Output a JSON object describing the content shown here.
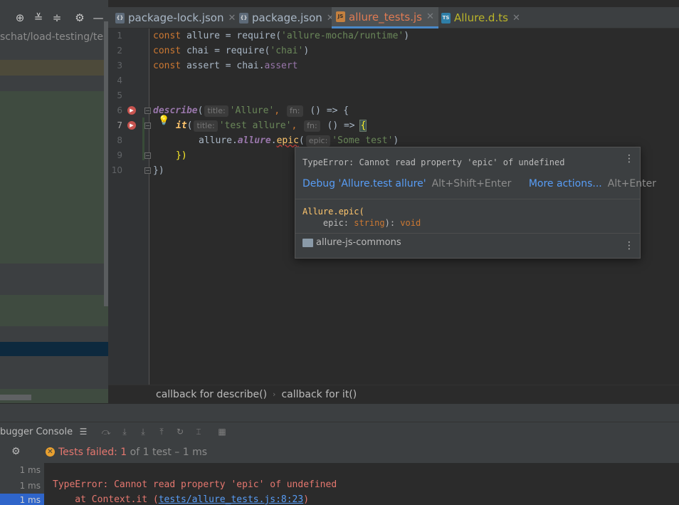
{
  "project_panel": {
    "path": "schat/load-testing/tes"
  },
  "tabs": [
    {
      "label": "package-lock.json",
      "icon": "json-file-icon"
    },
    {
      "label": "package.json",
      "icon": "json-file-icon"
    },
    {
      "label": "allure_tests.js",
      "icon": "js-file-icon",
      "active": true
    },
    {
      "label": "Allure.d.ts",
      "icon": "ts-file-icon"
    }
  ],
  "editor": {
    "line_numbers": [
      "1",
      "2",
      "3",
      "4",
      "5",
      "6",
      "7",
      "8",
      "9",
      "10"
    ],
    "hints": {
      "title": "title:",
      "fn": "fn:",
      "epic": "epic:"
    },
    "line1": {
      "kw": "const",
      "name": " allure = require(",
      "str": "'allure-mocha/runtime'",
      "end": ")"
    },
    "line2": {
      "kw": "const",
      "name": " chai = require(",
      "str": "'chai'",
      "end": ")"
    },
    "line3": {
      "kw": "const",
      "name": " assert = chai.",
      "prop": "assert"
    },
    "line6": {
      "fn": "describe",
      "open": "(",
      "str": "'Allure'",
      "comma": ",",
      "arrow": " () => {"
    },
    "line7": {
      "fn": "it",
      "open": "(",
      "str": "'test allure'",
      "comma": ",",
      "arrow": " () => ",
      "brace": "{"
    },
    "line8": {
      "obj": "allure.",
      "prop": "allure",
      "dot": ".",
      "method": "epic",
      "open": "(",
      "str": "'Some test'",
      "end": ")"
    },
    "line9": {
      "text": "})"
    },
    "line10": {
      "text": "})"
    }
  },
  "popup": {
    "error": "TypeError: Cannot read property 'epic' of undefined",
    "action1": "Debug 'Allure.test allure'",
    "action1_shortcut": "Alt+Shift+Enter",
    "action2": "More actions...",
    "action2_shortcut": "Alt+Enter",
    "signature_line1": "Allure.epic(",
    "signature_param": "    epic: ",
    "signature_type": "string",
    "signature_close": "): ",
    "signature_return": "void",
    "module": "allure-js-commons"
  },
  "breadcrumb": {
    "item1": "callback for describe()",
    "sep": "›",
    "item2": "callback for it()"
  },
  "run_panel": {
    "console_tab": "bugger Console",
    "status_failed": "Tests failed: ",
    "status_failed_count": "1",
    "status_rest": " of 1 test – 1 ms",
    "durations": [
      "1 ms",
      "1 ms",
      "1 ms"
    ],
    "error_line": "TypeError: Cannot read property 'epic' of undefined",
    "stack_prefix": "    at Context.it (",
    "stack_link": "tests/allure_tests.js:8:23",
    "stack_suffix": ")"
  },
  "colors": {
    "accent": "#4a88c7",
    "error": "#e5776f",
    "link": "#589df6"
  }
}
